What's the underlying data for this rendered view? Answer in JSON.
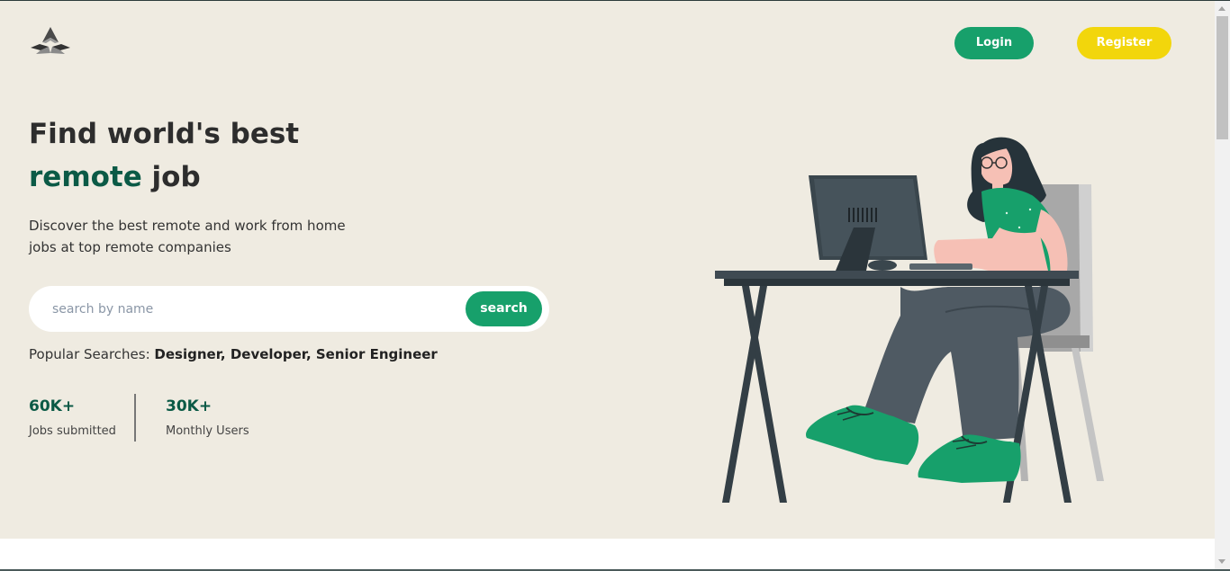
{
  "header": {
    "logo_icon": "triangle-logo-icon",
    "login_label": "Login",
    "register_label": "Register"
  },
  "hero": {
    "title_line1": "Find world's best",
    "title_accent": "remote",
    "title_rest": " job",
    "description": "Discover the best remote and work from home\njobs at top remote companies"
  },
  "search": {
    "placeholder": "search by name",
    "value": "",
    "button_label": "search"
  },
  "popular": {
    "label": "Popular Searches: ",
    "items": "Designer, Developer, Senior Engineer"
  },
  "stats": [
    {
      "value": "60K+",
      "label": "Jobs submitted"
    },
    {
      "value": "30K+",
      "label": "Monthly Users"
    }
  ],
  "colors": {
    "hero_bg": "#efebe1",
    "primary_green": "#17a06b",
    "accent_dark_green": "#0b5a46",
    "register_yellow": "#f2d60c"
  },
  "illustration": "woman-working-at-computer-desk"
}
